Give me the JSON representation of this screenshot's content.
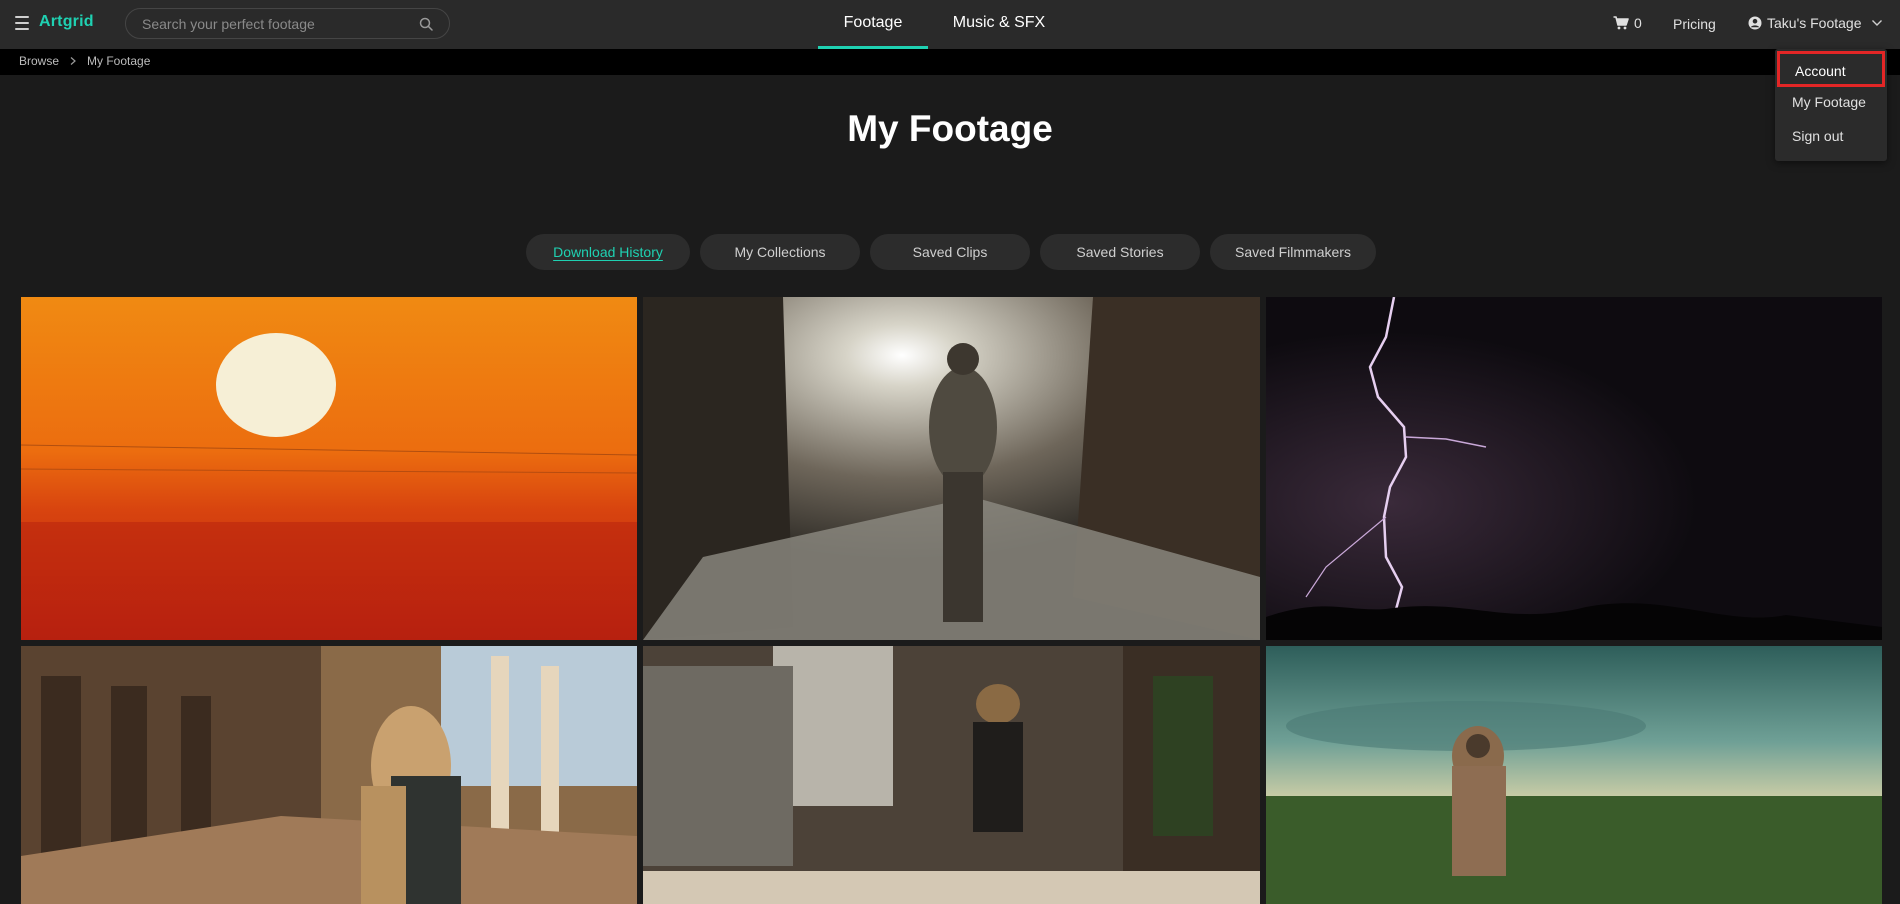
{
  "header": {
    "logo": "Artgrid",
    "search_placeholder": "Search your perfect footage",
    "tabs": [
      {
        "label": "Footage",
        "active": true
      },
      {
        "label": "Music & SFX",
        "active": false
      }
    ],
    "cart_count": "0",
    "pricing_label": "Pricing",
    "account_label": "Taku's Footage"
  },
  "breadcrumb": [
    "Browse",
    "My Footage"
  ],
  "page_title": "My Footage",
  "subtabs": [
    {
      "label": "Download History",
      "active": true
    },
    {
      "label": "My Collections",
      "active": false
    },
    {
      "label": "Saved Clips",
      "active": false
    },
    {
      "label": "Saved Stories",
      "active": false
    },
    {
      "label": "Saved Filmmakers",
      "active": false
    }
  ],
  "dropdown": {
    "items": [
      "Account",
      "My Footage",
      "Sign out"
    ],
    "highlighted": "Account"
  },
  "colors": {
    "accent": "#1fd1b2",
    "highlight_box": "#e32626",
    "topbar": "#2a2a2a",
    "page_bg": "#1b1b1b"
  },
  "icons": [
    "hamburger-icon",
    "search-icon",
    "cart-icon",
    "user-circle-icon",
    "chevron-down-icon",
    "chevron-right-icon"
  ]
}
